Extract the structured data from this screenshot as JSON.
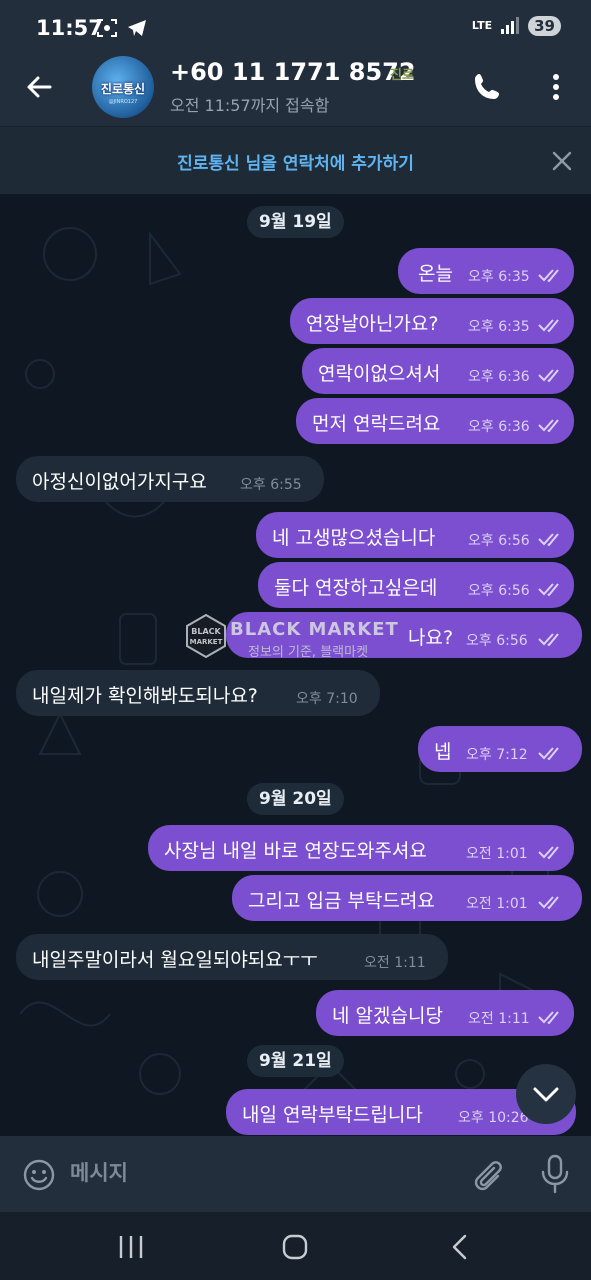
{
  "status_bar": {
    "time": "11:57",
    "network": "LTE",
    "battery": "39",
    "icons": [
      "screenshot-icon",
      "telegram-icon",
      "signal-icon"
    ]
  },
  "header": {
    "contact_name": "+60 11 1771 8572",
    "contact_tag": "진로",
    "last_seen": "오전 11:57까지 접속함",
    "avatar_text": "진로통신",
    "avatar_subtext": "@JINRO127"
  },
  "add_contact_bar": {
    "text": "진로통신 님을 연락처에 추가하기"
  },
  "chat": {
    "dates": [
      "9월 19일",
      "9월 20일",
      "9월 21일"
    ],
    "messages": [
      {
        "dir": "out",
        "text": "온늘",
        "time": "오후 6:35",
        "read": true
      },
      {
        "dir": "out",
        "text": "연장날아닌가요?",
        "time": "오후 6:35",
        "read": true
      },
      {
        "dir": "out",
        "text": "연락이없으셔서",
        "time": "오후 6:36",
        "read": true
      },
      {
        "dir": "out",
        "text": "먼저 연락드려요",
        "time": "오후 6:36",
        "read": true
      },
      {
        "dir": "in",
        "text": "아정신이없어가지구요",
        "time": "오후 6:55"
      },
      {
        "dir": "out",
        "text": "네 고생많으셨습니다",
        "time": "오후 6:56",
        "read": true
      },
      {
        "dir": "out",
        "text": "둘다 연장하고싶은데",
        "time": "오후 6:56",
        "read": true
      },
      {
        "dir": "out",
        "text": "나요?",
        "time": "오후 6:56",
        "read": true
      },
      {
        "dir": "in",
        "text": "내일제가 확인해봐도되나요?",
        "time": "오후 7:10"
      },
      {
        "dir": "out",
        "text": "넵",
        "time": "오후 7:12",
        "read": true
      },
      {
        "dir": "out",
        "text": "사장님 내일 바로 연장도와주셔요",
        "time": "오전 1:01",
        "read": true
      },
      {
        "dir": "out",
        "text": "그리고 입금 부탁드려요",
        "time": "오전 1:01",
        "read": true
      },
      {
        "dir": "in",
        "text": "내일주말이라서 월요일되야되요ㅜㅜ",
        "time": "오전 1:11"
      },
      {
        "dir": "out",
        "text": "네 알겠습니당",
        "time": "오전 1:11",
        "read": true
      },
      {
        "dir": "out",
        "text": "내일 연락부탁드립니다",
        "time": "오후 10:26",
        "read": true
      }
    ]
  },
  "watermark": {
    "badge_text": "BLACK MARKET",
    "title": "BLACK MARKET",
    "subtitle": "정보의 기준, 블랙마켓"
  },
  "input_bar": {
    "placeholder": "메시지"
  },
  "colors": {
    "outgoing_bubble": "#7b4fd0",
    "incoming_bubble": "#1f2b39",
    "header_bg": "#232e3c",
    "accent_link": "#5fb4f0"
  }
}
